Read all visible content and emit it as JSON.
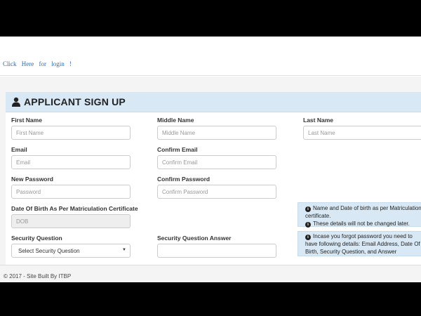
{
  "header": {
    "login_link": "Click Here for login !"
  },
  "panel": {
    "title": "APPLICANT SIGN UP",
    "icon": "user-icon"
  },
  "form": {
    "first_name": {
      "label": "First Name",
      "placeholder": "First Name"
    },
    "middle_name": {
      "label": "Middle Name",
      "placeholder": "Middle Name"
    },
    "last_name": {
      "label": "Last Name",
      "placeholder": "Last Name"
    },
    "email": {
      "label": "Email",
      "placeholder": "Email"
    },
    "confirm_email": {
      "label": "Confirm Email",
      "placeholder": "Confirm Email"
    },
    "new_password": {
      "label": "New Password",
      "placeholder": "Password"
    },
    "confirm_password": {
      "label": "Confirm Password",
      "placeholder": "Confirm Password"
    },
    "dob": {
      "label": "Date Of Birth As Per Matriculation Certificate",
      "placeholder": "DOB"
    },
    "security_question": {
      "label": "Security Question",
      "selected": "Select Security Question"
    },
    "security_answer": {
      "label": "Security Question Answer",
      "placeholder": ""
    }
  },
  "info": {
    "dob_note_1": "Name and Date of birth as per Matriculation certificate.",
    "dob_note_2": "These details will not be changed later.",
    "security_note": "Incase you forgot password you need to have following details: Email Address, Date Of Birth, Security Question, and Answer"
  },
  "footer": {
    "text": "© 2017 - Site Built By ITBP"
  },
  "colors": {
    "panel_heading_bg": "#d8e9f5",
    "link": "#2a6db5",
    "alert_bg": "#f2dede"
  }
}
